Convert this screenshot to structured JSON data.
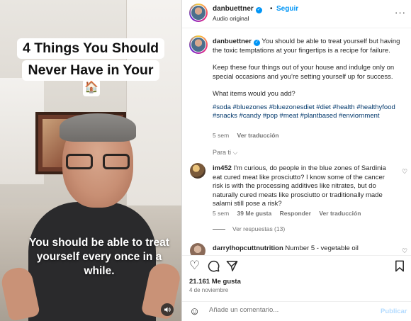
{
  "video": {
    "title_lines": [
      "4 Things You Should",
      "Never Have in Your"
    ],
    "house_emoji": "🏠",
    "caption": "You should be able to treat yourself every once in a while.",
    "mute_icon": "speaker-icon"
  },
  "header": {
    "username": "danbuettner",
    "verified": "✓",
    "dot": "•",
    "follow_label": "Seguir",
    "audio_label": "Audio original",
    "more_label": "···"
  },
  "post": {
    "username": "danbuettner",
    "caption_intro": "You should be able to treat yourself but having the toxic temptations at your fingertips is a recipe for failure.",
    "caption_p2": "Keep these four things out of your house and indulge only on special occasions and you’re setting yourself up for success.",
    "caption_p3": "What items would you add?",
    "hashtags": "#soda #bluezones #bluezonesdiet #diet #health #healthyfood #snacks #candy #pop #meat #plantbased #enviornment",
    "time": "5 sem",
    "see_translation": "Ver traducción",
    "para_ti": "Para ti ⌵"
  },
  "comments": [
    {
      "username": "im452",
      "text": "I'm curious, do people in the blue zones of Sardinia eat cured meat like prosciutto? I know some of the cancer risk is with the processing additives like nitrates, but do naturally cured meats like prosciutto or traditionally made salami still pose a risk?",
      "time": "5 sem",
      "likes": "39 Me gusta",
      "reply": "Responder",
      "see_translation": "Ver traducción",
      "view_replies": "Ver respuestas (13)"
    },
    {
      "username": "darrylhopcuttnutrition",
      "text": "Number 5 - vegetable oil"
    }
  ],
  "actions": {
    "like_icon": "♡",
    "comment_icon": "◯",
    "share_icon": "➢",
    "save_icon": "▯",
    "likes_count": "21.161 Me gusta",
    "date": "4 de noviembre"
  },
  "comment_bar": {
    "emoji_icon": "☺",
    "placeholder": "Añade un comentario...",
    "publish_label": "Publicar"
  },
  "colors": {
    "accent": "#0095f6",
    "link": "#00376b",
    "muted": "#737373",
    "publish_disabled": "#b3dbff"
  }
}
